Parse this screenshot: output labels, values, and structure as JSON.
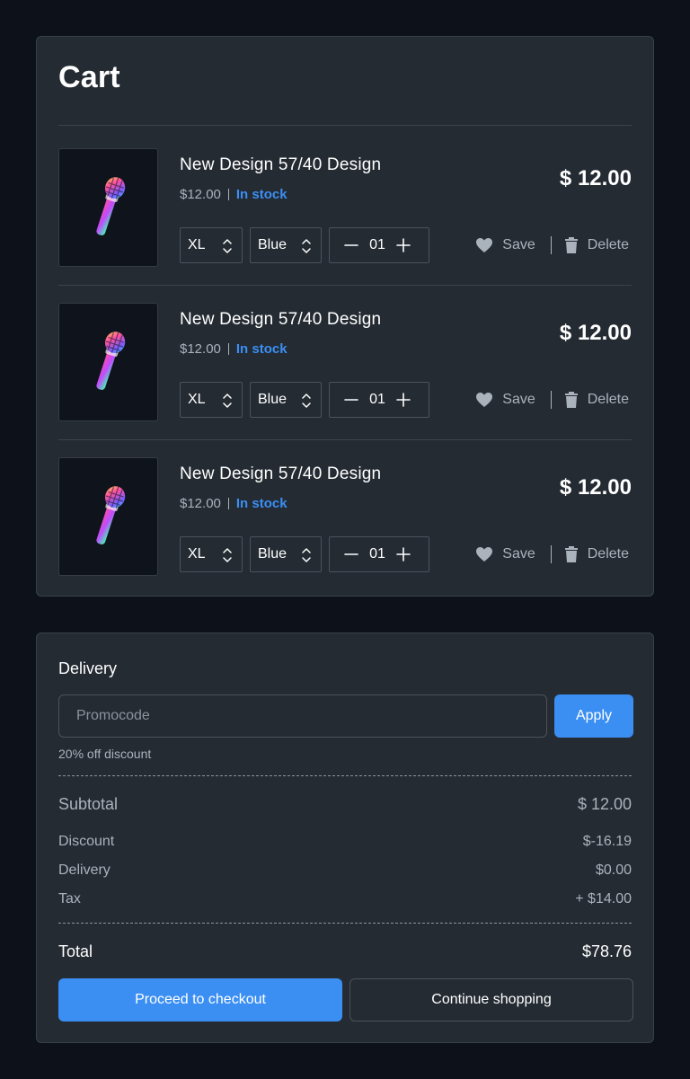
{
  "cart": {
    "title": "Cart",
    "items": [
      {
        "name": "New Design 57/40 Design",
        "unit_price": "$12.00",
        "stock": "In stock",
        "price": "$ 12.00",
        "size": "XL",
        "color": "Blue",
        "quantity": "01",
        "save_label": "Save",
        "delete_label": "Delete"
      },
      {
        "name": "New Design 57/40 Design",
        "unit_price": "$12.00",
        "stock": "In stock",
        "price": "$ 12.00",
        "size": "XL",
        "color": "Blue",
        "quantity": "01",
        "save_label": "Save",
        "delete_label": "Delete"
      },
      {
        "name": "New Design 57/40 Design",
        "unit_price": "$12.00",
        "stock": "In stock",
        "price": "$ 12.00",
        "size": "XL",
        "color": "Blue",
        "quantity": "01",
        "save_label": "Save",
        "delete_label": "Delete"
      }
    ]
  },
  "summary": {
    "delivery_title": "Delivery",
    "promo_placeholder": "Promocode",
    "apply_label": "Apply",
    "promo_note": "20% off discount",
    "subtotal_label": "Subtotal",
    "subtotal_value": "$ 12.00",
    "discount_label": "Discount",
    "discount_value": "$-16.19",
    "delivery_label": "Delivery",
    "delivery_value": "$0.00",
    "tax_label": "Tax",
    "tax_value": "+ $14.00",
    "total_label": "Total",
    "total_value": "$78.76",
    "checkout_label": "Proceed to checkout",
    "continue_label": "Continue shopping"
  },
  "colors": {
    "background": "#0d121a",
    "panel": "#242b33",
    "accent": "#3b8ff3",
    "text_muted": "#aab2bc"
  },
  "icons": [
    "microphone-icon",
    "chevron-up-down-icon",
    "minus-icon",
    "plus-icon",
    "heart-icon",
    "trash-icon"
  ]
}
